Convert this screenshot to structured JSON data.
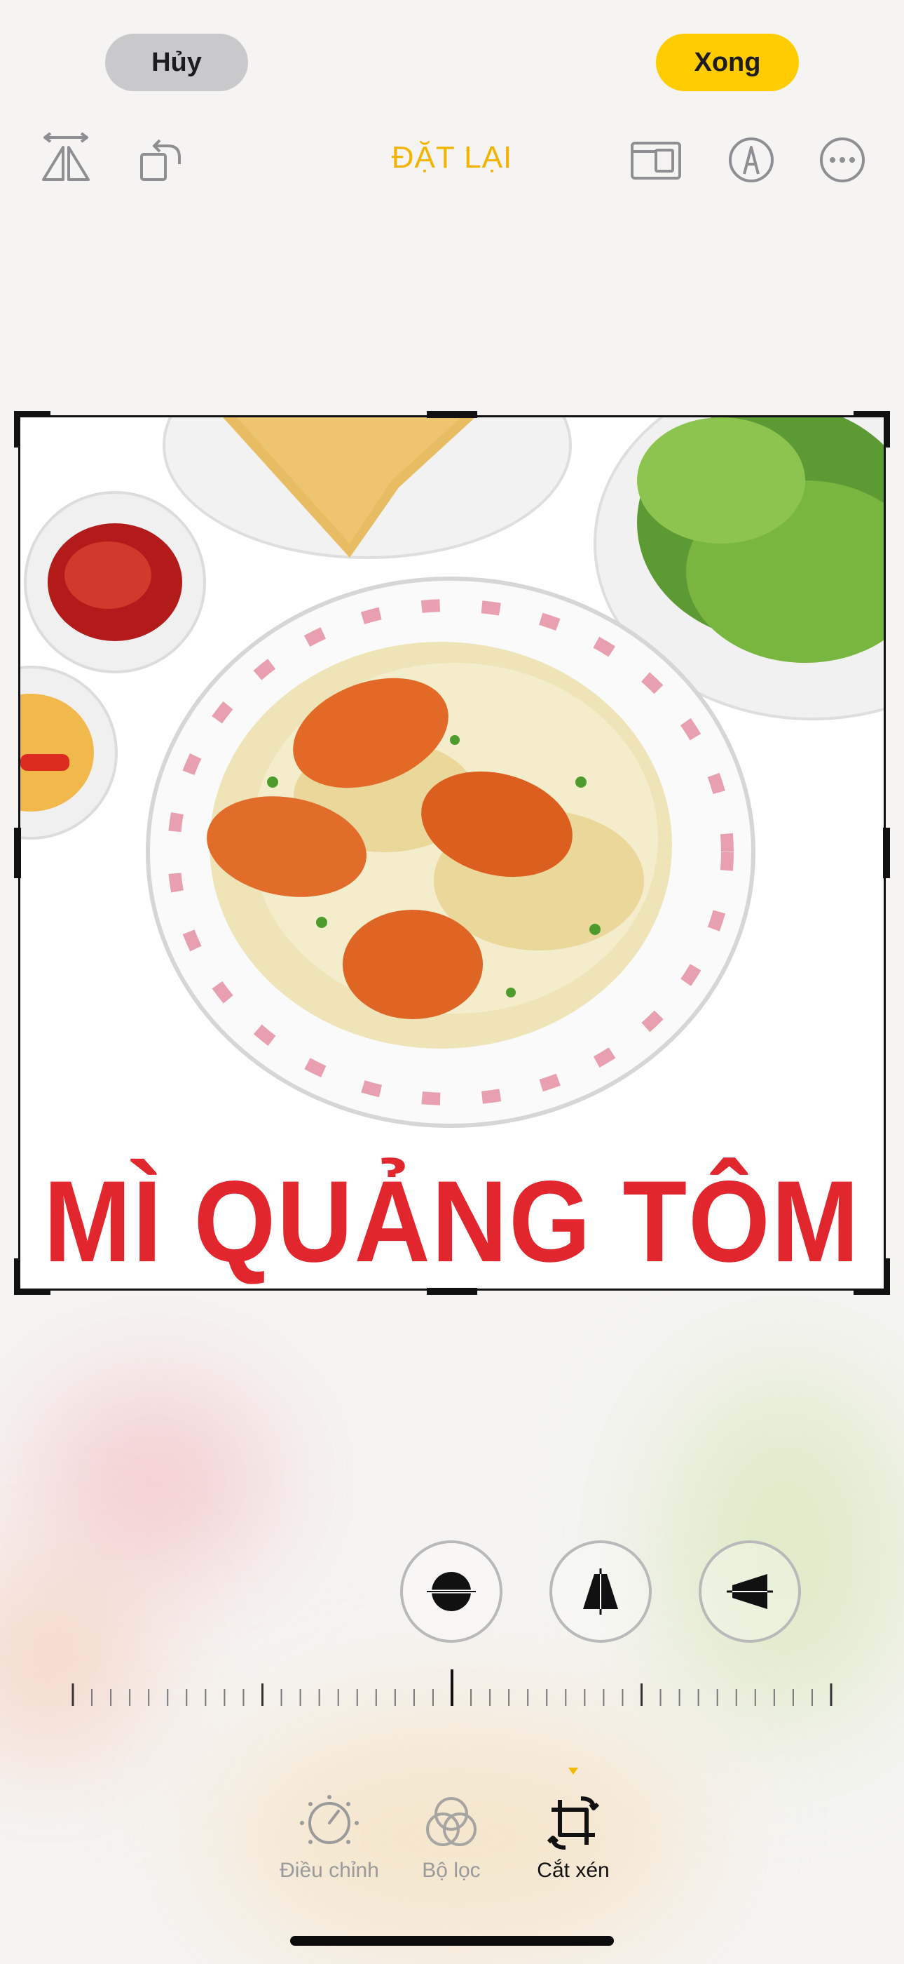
{
  "header": {
    "cancel_label": "Hủy",
    "done_label": "Xong"
  },
  "toolbar": {
    "reset_label": "ĐẶT LẠI",
    "left_icons": [
      "flip-horizontal-icon",
      "rotate-icon"
    ],
    "right_icons": [
      "aspect-ratio-icon",
      "markup-pen-icon",
      "more-icon"
    ]
  },
  "photo": {
    "title_text": "MÌ QUẢNG TÔM"
  },
  "perspective": {
    "options": [
      "straighten-icon",
      "vertical-perspective-icon",
      "horizontal-perspective-icon"
    ]
  },
  "tabs": [
    {
      "label": "Điều chỉnh",
      "icon": "adjust-dial-icon",
      "active": false
    },
    {
      "label": "Bộ lọc",
      "icon": "filters-icon",
      "active": false
    },
    {
      "label": "Cắt xén",
      "icon": "crop-icon",
      "active": true
    }
  ],
  "colors": {
    "accent": "#f3b400",
    "done_bg": "#ffcc00",
    "title_red": "#e1272d"
  }
}
